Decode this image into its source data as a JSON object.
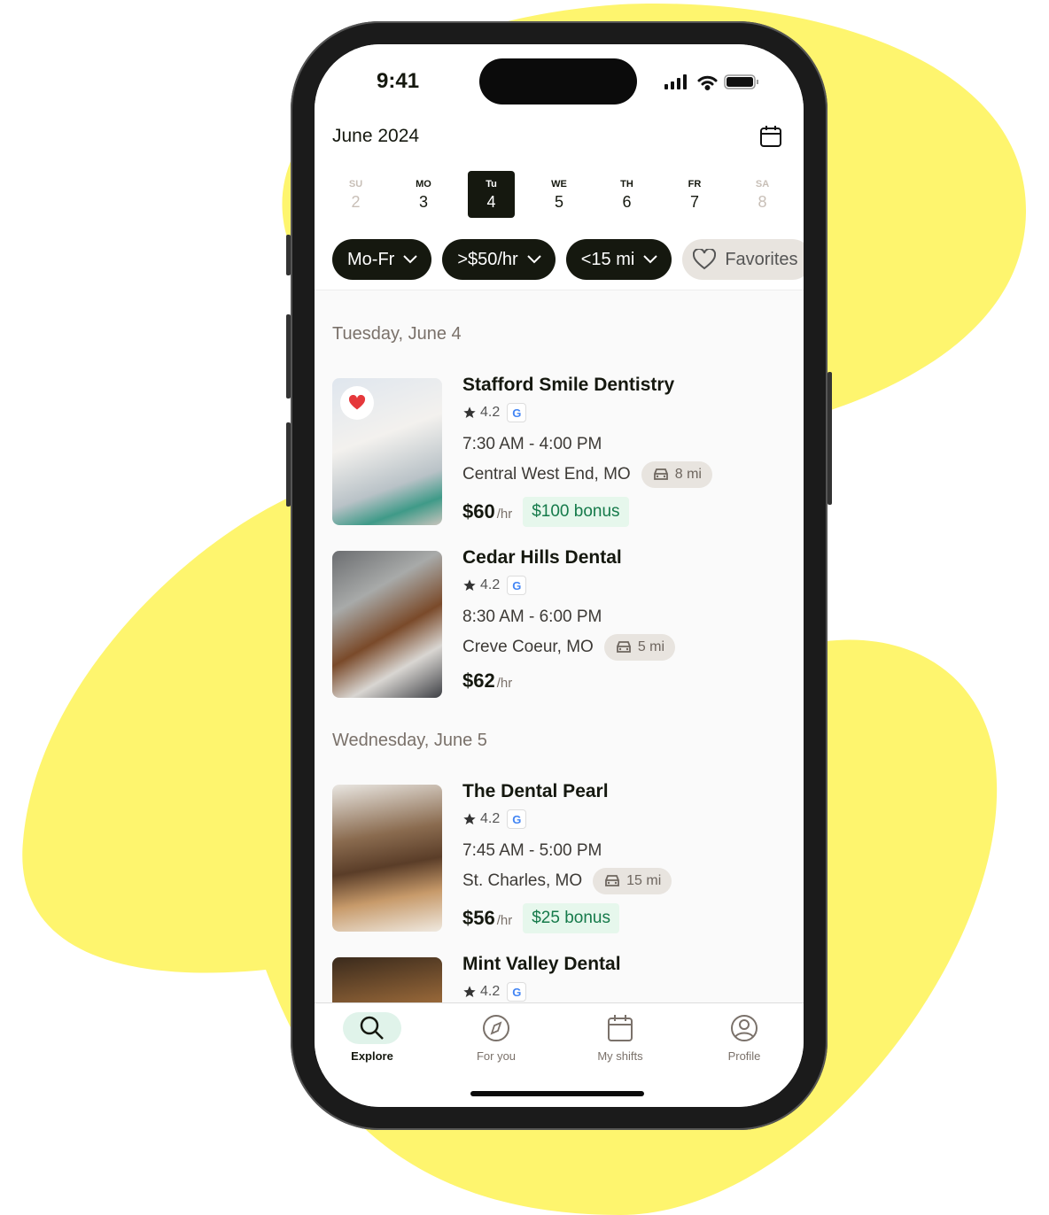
{
  "colors": {
    "background_blob": "#FEF56E",
    "accent_dark": "#15180F",
    "bonus_green": "#157A4A",
    "favorite_red": "#E5383B"
  },
  "status_bar": {
    "time": "9:41",
    "icons": [
      "signal-icon",
      "wifi-icon",
      "battery-icon"
    ]
  },
  "header": {
    "month": "June 2024",
    "calendar_icon": "calendar-icon"
  },
  "days": [
    {
      "name": "SU",
      "date": "2",
      "state": "muted"
    },
    {
      "name": "MO",
      "date": "3",
      "state": "normal"
    },
    {
      "name": "Tu",
      "date": "4",
      "state": "selected"
    },
    {
      "name": "WE",
      "date": "5",
      "state": "normal"
    },
    {
      "name": "TH",
      "date": "6",
      "state": "normal"
    },
    {
      "name": "FR",
      "date": "7",
      "state": "normal"
    },
    {
      "name": "SA",
      "date": "8",
      "state": "muted"
    }
  ],
  "filters": [
    {
      "label": "Mo-Fr"
    },
    {
      "label": ">$50/hr"
    },
    {
      "label": "<15 mi"
    },
    {
      "label": "Favorites"
    }
  ],
  "sections": [
    {
      "title": "Tuesday, June 4",
      "listings": [
        {
          "name": "Stafford Smile Dentistry",
          "rating": "4.2",
          "hours": "7:30 AM - 4:00 PM",
          "location": "Central West End, MO",
          "distance": "8 mi",
          "rate": "$60",
          "unit": "/hr",
          "bonus": "$100 bonus",
          "favorited": true
        },
        {
          "name": "Cedar Hills Dental",
          "rating": "4.2",
          "hours": "8:30 AM - 6:00 PM",
          "location": "Creve Coeur, MO",
          "distance": "5 mi",
          "rate": "$62",
          "unit": "/hr",
          "bonus": null,
          "favorited": false
        }
      ]
    },
    {
      "title": "Wednesday, June 5",
      "listings": [
        {
          "name": "The Dental Pearl",
          "rating": "4.2",
          "hours": "7:45 AM - 5:00 PM",
          "location": "St. Charles, MO",
          "distance": "15 mi",
          "rate": "$56",
          "unit": "/hr",
          "bonus": "$25 bonus",
          "favorited": false
        },
        {
          "name": "Mint Valley Dental",
          "rating": "4.2"
        }
      ]
    }
  ],
  "tabs": [
    {
      "label": "Explore",
      "icon": "search-icon",
      "active": true
    },
    {
      "label": "For you",
      "icon": "compass-icon"
    },
    {
      "label": "My shifts",
      "icon": "calendar-icon"
    },
    {
      "label": "Profile",
      "icon": "user-icon"
    }
  ]
}
